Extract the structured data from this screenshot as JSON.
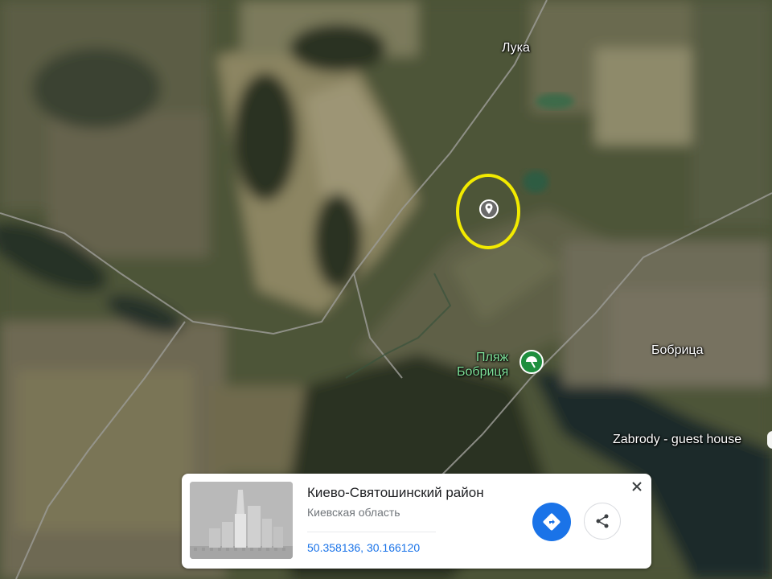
{
  "map": {
    "type": "satellite",
    "labels": {
      "luka": "Лука",
      "bobritsa": "Бобрица",
      "beach_line1": "Пляж",
      "beach_line2": "Бобриця",
      "guest_house": "Zabrody - guest house"
    },
    "highlight_color": "#f2ea00"
  },
  "card": {
    "place_name": "Киево-Святошинский район",
    "region": "Киевская область",
    "coordinates": "50.358136, 30.166120",
    "accent": "#1a73e8",
    "icons": {
      "close": "close-icon",
      "directions": "directions-icon",
      "share": "share-icon"
    }
  }
}
